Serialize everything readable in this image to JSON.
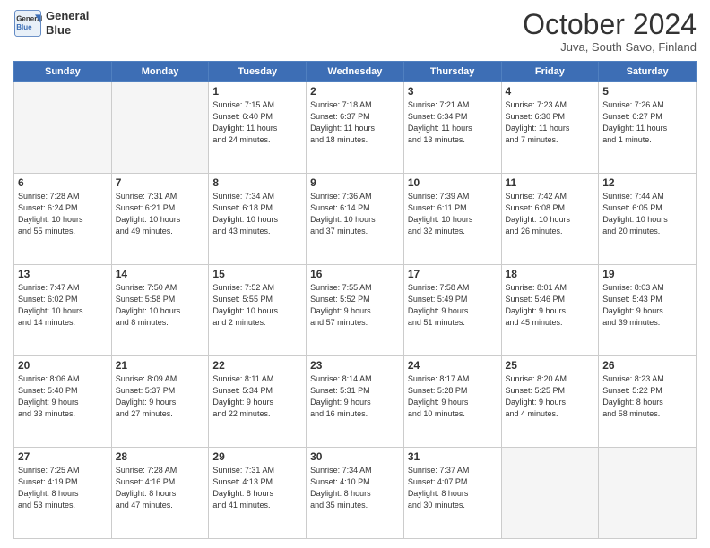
{
  "header": {
    "logo_line1": "General",
    "logo_line2": "Blue",
    "title": "October 2024",
    "subtitle": "Juva, South Savo, Finland"
  },
  "days_of_week": [
    "Sunday",
    "Monday",
    "Tuesday",
    "Wednesday",
    "Thursday",
    "Friday",
    "Saturday"
  ],
  "weeks": [
    [
      {
        "day": "",
        "info": ""
      },
      {
        "day": "",
        "info": ""
      },
      {
        "day": "1",
        "info": "Sunrise: 7:15 AM\nSunset: 6:40 PM\nDaylight: 11 hours\nand 24 minutes."
      },
      {
        "day": "2",
        "info": "Sunrise: 7:18 AM\nSunset: 6:37 PM\nDaylight: 11 hours\nand 18 minutes."
      },
      {
        "day": "3",
        "info": "Sunrise: 7:21 AM\nSunset: 6:34 PM\nDaylight: 11 hours\nand 13 minutes."
      },
      {
        "day": "4",
        "info": "Sunrise: 7:23 AM\nSunset: 6:30 PM\nDaylight: 11 hours\nand 7 minutes."
      },
      {
        "day": "5",
        "info": "Sunrise: 7:26 AM\nSunset: 6:27 PM\nDaylight: 11 hours\nand 1 minute."
      }
    ],
    [
      {
        "day": "6",
        "info": "Sunrise: 7:28 AM\nSunset: 6:24 PM\nDaylight: 10 hours\nand 55 minutes."
      },
      {
        "day": "7",
        "info": "Sunrise: 7:31 AM\nSunset: 6:21 PM\nDaylight: 10 hours\nand 49 minutes."
      },
      {
        "day": "8",
        "info": "Sunrise: 7:34 AM\nSunset: 6:18 PM\nDaylight: 10 hours\nand 43 minutes."
      },
      {
        "day": "9",
        "info": "Sunrise: 7:36 AM\nSunset: 6:14 PM\nDaylight: 10 hours\nand 37 minutes."
      },
      {
        "day": "10",
        "info": "Sunrise: 7:39 AM\nSunset: 6:11 PM\nDaylight: 10 hours\nand 32 minutes."
      },
      {
        "day": "11",
        "info": "Sunrise: 7:42 AM\nSunset: 6:08 PM\nDaylight: 10 hours\nand 26 minutes."
      },
      {
        "day": "12",
        "info": "Sunrise: 7:44 AM\nSunset: 6:05 PM\nDaylight: 10 hours\nand 20 minutes."
      }
    ],
    [
      {
        "day": "13",
        "info": "Sunrise: 7:47 AM\nSunset: 6:02 PM\nDaylight: 10 hours\nand 14 minutes."
      },
      {
        "day": "14",
        "info": "Sunrise: 7:50 AM\nSunset: 5:58 PM\nDaylight: 10 hours\nand 8 minutes."
      },
      {
        "day": "15",
        "info": "Sunrise: 7:52 AM\nSunset: 5:55 PM\nDaylight: 10 hours\nand 2 minutes."
      },
      {
        "day": "16",
        "info": "Sunrise: 7:55 AM\nSunset: 5:52 PM\nDaylight: 9 hours\nand 57 minutes."
      },
      {
        "day": "17",
        "info": "Sunrise: 7:58 AM\nSunset: 5:49 PM\nDaylight: 9 hours\nand 51 minutes."
      },
      {
        "day": "18",
        "info": "Sunrise: 8:01 AM\nSunset: 5:46 PM\nDaylight: 9 hours\nand 45 minutes."
      },
      {
        "day": "19",
        "info": "Sunrise: 8:03 AM\nSunset: 5:43 PM\nDaylight: 9 hours\nand 39 minutes."
      }
    ],
    [
      {
        "day": "20",
        "info": "Sunrise: 8:06 AM\nSunset: 5:40 PM\nDaylight: 9 hours\nand 33 minutes."
      },
      {
        "day": "21",
        "info": "Sunrise: 8:09 AM\nSunset: 5:37 PM\nDaylight: 9 hours\nand 27 minutes."
      },
      {
        "day": "22",
        "info": "Sunrise: 8:11 AM\nSunset: 5:34 PM\nDaylight: 9 hours\nand 22 minutes."
      },
      {
        "day": "23",
        "info": "Sunrise: 8:14 AM\nSunset: 5:31 PM\nDaylight: 9 hours\nand 16 minutes."
      },
      {
        "day": "24",
        "info": "Sunrise: 8:17 AM\nSunset: 5:28 PM\nDaylight: 9 hours\nand 10 minutes."
      },
      {
        "day": "25",
        "info": "Sunrise: 8:20 AM\nSunset: 5:25 PM\nDaylight: 9 hours\nand 4 minutes."
      },
      {
        "day": "26",
        "info": "Sunrise: 8:23 AM\nSunset: 5:22 PM\nDaylight: 8 hours\nand 58 minutes."
      }
    ],
    [
      {
        "day": "27",
        "info": "Sunrise: 7:25 AM\nSunset: 4:19 PM\nDaylight: 8 hours\nand 53 minutes."
      },
      {
        "day": "28",
        "info": "Sunrise: 7:28 AM\nSunset: 4:16 PM\nDaylight: 8 hours\nand 47 minutes."
      },
      {
        "day": "29",
        "info": "Sunrise: 7:31 AM\nSunset: 4:13 PM\nDaylight: 8 hours\nand 41 minutes."
      },
      {
        "day": "30",
        "info": "Sunrise: 7:34 AM\nSunset: 4:10 PM\nDaylight: 8 hours\nand 35 minutes."
      },
      {
        "day": "31",
        "info": "Sunrise: 7:37 AM\nSunset: 4:07 PM\nDaylight: 8 hours\nand 30 minutes."
      },
      {
        "day": "",
        "info": ""
      },
      {
        "day": "",
        "info": ""
      }
    ]
  ]
}
